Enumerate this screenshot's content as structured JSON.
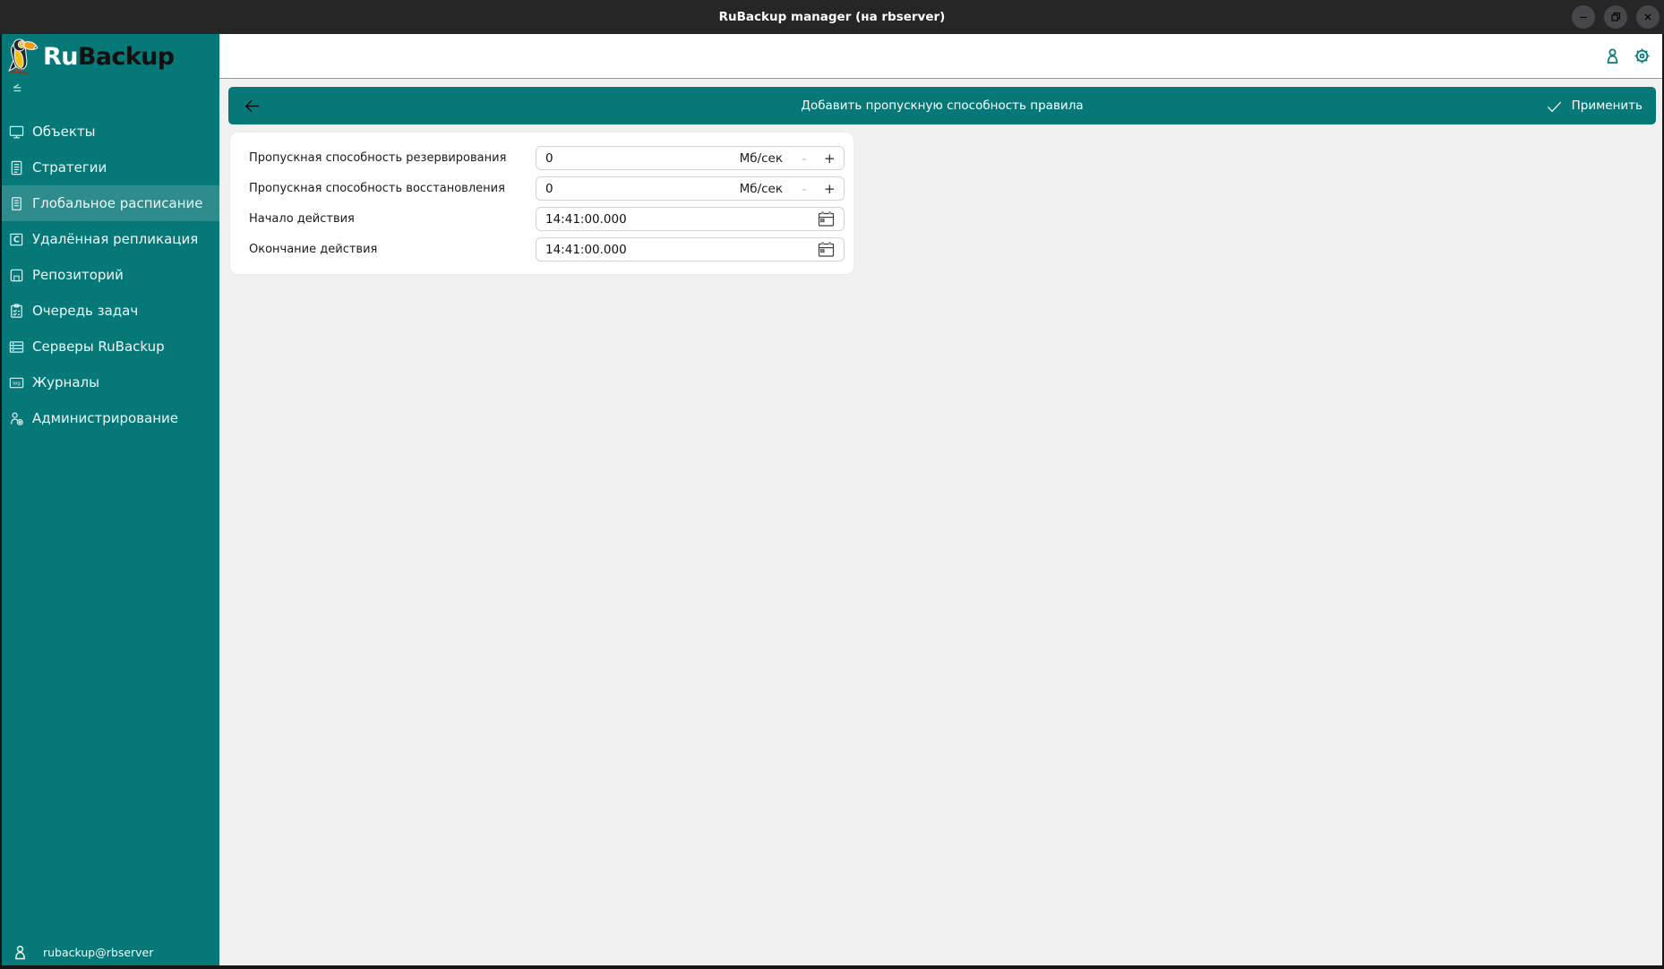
{
  "window": {
    "title": "RuBackup manager (на rbserver)",
    "controls": [
      "minimize",
      "restore",
      "close"
    ]
  },
  "brand": {
    "ru": "Ru",
    "backup": "Backup"
  },
  "sidebar": {
    "collapse_icon": "collapse-sidebar-icon",
    "items": [
      {
        "id": "objects",
        "label": "Объекты",
        "icon": "monitor-icon",
        "selected": false
      },
      {
        "id": "strategies",
        "label": "Стратегии",
        "icon": "document-icon",
        "selected": false
      },
      {
        "id": "global-schedule",
        "label": "Глобальное расписание",
        "icon": "schedule-icon",
        "selected": true
      },
      {
        "id": "remote-replication",
        "label": "Удалённая репликация",
        "icon": "replication-icon",
        "selected": false
      },
      {
        "id": "repository",
        "label": "Репозиторий",
        "icon": "repository-icon",
        "selected": false
      },
      {
        "id": "task-queue",
        "label": "Очередь задач",
        "icon": "task-queue-icon",
        "selected": false
      },
      {
        "id": "servers",
        "label": "Серверы RuBackup",
        "icon": "servers-icon",
        "selected": false
      },
      {
        "id": "logs",
        "label": "Журналы",
        "icon": "logs-icon",
        "selected": false
      },
      {
        "id": "administration",
        "label": "Администрирование",
        "icon": "admin-gear-icon",
        "selected": false
      }
    ],
    "user": "rubackup@rbserver"
  },
  "toolbar": {
    "icons": [
      "user-icon",
      "gear-icon"
    ]
  },
  "header": {
    "title": "Добавить пропускную способность правила",
    "apply_label": "Применить"
  },
  "form": {
    "controls": {
      "minus": "-",
      "plus": "+"
    },
    "fields": [
      {
        "id": "backup-bandwidth",
        "label": "Пропускная способность резервирования",
        "value": "0",
        "unit": "Мб/сек",
        "type": "spin"
      },
      {
        "id": "restore-bandwidth",
        "label": "Пропускная способность восстановления",
        "value": "0",
        "unit": "Мб/сек",
        "type": "spin"
      },
      {
        "id": "start-time",
        "label": "Начало действия",
        "value": "14:41:00.000",
        "unit": "",
        "type": "time"
      },
      {
        "id": "end-time",
        "label": "Окончание действия",
        "value": "14:41:00.000",
        "unit": "",
        "type": "time"
      }
    ]
  },
  "colors": {
    "teal": "#067878",
    "teal_selected": "#2e8c8c",
    "titlebar_bg": "#262626",
    "content_bg": "#f1f1f2"
  }
}
